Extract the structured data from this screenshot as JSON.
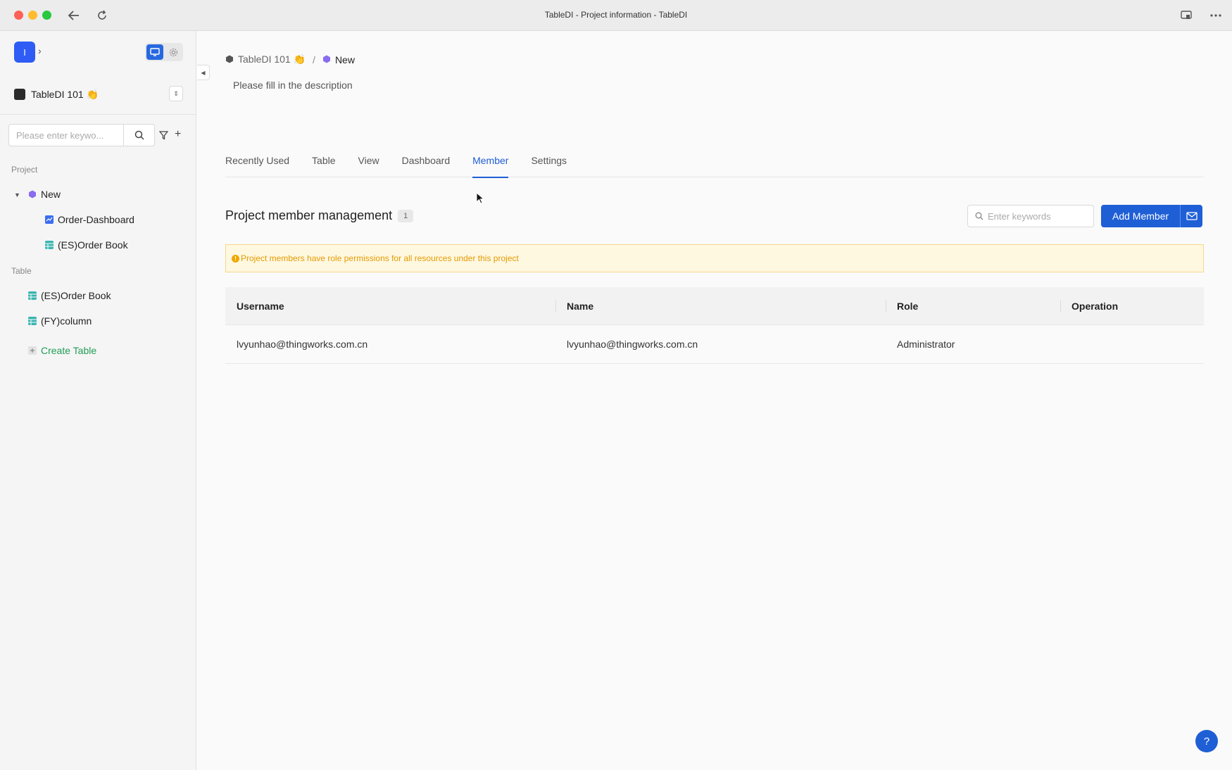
{
  "window": {
    "title": "TableDI - Project information - TableDI"
  },
  "sidebar": {
    "app_logo": "I",
    "workspace": {
      "name": "TableDI 101 👏"
    },
    "search": {
      "placeholder": "Please enter keywo..."
    },
    "project_section": "Project",
    "project": {
      "name": "New",
      "children": [
        {
          "label": "Order-Dashboard",
          "icon": "dashboard-icon"
        },
        {
          "label": "(ES)Order Book",
          "icon": "table-icon"
        }
      ]
    },
    "table_section": "Table",
    "tables": [
      {
        "label": "(ES)Order Book",
        "icon": "table-icon"
      },
      {
        "label": "(FY)column",
        "icon": "table-icon"
      }
    ],
    "create_table": "Create Table"
  },
  "main": {
    "breadcrumb": {
      "workspace": "TableDI 101 👏",
      "separator": "/",
      "project": "New"
    },
    "description": "Please fill in the description",
    "tabs": [
      "Recently Used",
      "Table",
      "View",
      "Dashboard",
      "Member",
      "Settings"
    ],
    "active_tab": "Member",
    "section_title": "Project member management",
    "member_count": "1",
    "search": {
      "placeholder": "Enter keywords"
    },
    "add_member_label": "Add Member",
    "notice": "Project members have role permissions for all resources under this project",
    "table": {
      "headers": [
        "Username",
        "Name",
        "Role",
        "Operation"
      ],
      "rows": [
        [
          "lvyunhao@thingworks.com.cn",
          "lvyunhao@thingworks.com.cn",
          "Administrator",
          ""
        ]
      ]
    },
    "help": "?"
  },
  "colors": {
    "accent": "#1f5fd6",
    "brand": "#2e5cf5",
    "create_green": "#1f9d55",
    "notice_bg": "#fff8e1",
    "notice_text": "#e39a00"
  }
}
